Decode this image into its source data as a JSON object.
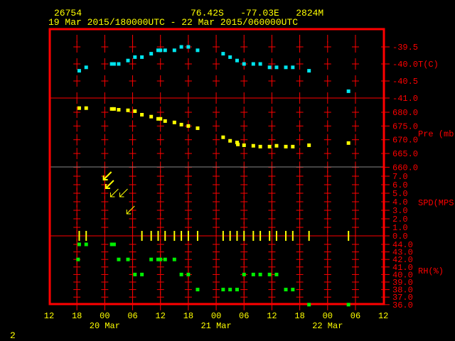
{
  "header": {
    "station": "26754",
    "location": "76.42S   -77.03E   2824M",
    "period": "19 Mar 2015/180000UTC - 22 Mar 2015/060000UTC"
  },
  "footer": {
    "page": "2"
  },
  "colors": {
    "frame": "#ff0000",
    "temperature": "#00e5ee",
    "pressure": "#ffff00",
    "wind": "#ffff00",
    "rh": "#00ee00",
    "text": "#ffff00",
    "axis_text": "#ff0000"
  },
  "chart_data": {
    "type": "scatter",
    "x_axis": {
      "range": [
        "2015-03-19 12:00",
        "2015-03-22 12:00"
      ],
      "tick_labels": [
        "12",
        "18",
        "00",
        "06",
        "12",
        "18",
        "00",
        "06",
        "12",
        "18",
        "00",
        "06",
        "12"
      ],
      "day_labels": [
        "20 Mar",
        "21 Mar",
        "22 Mar"
      ]
    },
    "panels": [
      {
        "id": "temperature",
        "unit_label": "T(C)",
        "ylim": [
          -41.0,
          -39.5
        ],
        "tick_labels": [
          "-39.5",
          "-40.0",
          "-40.5",
          "-41.0"
        ],
        "points": [
          [
            "2015-03-19 18:30",
            -40.2
          ],
          [
            "2015-03-19 20:00",
            -40.1
          ],
          [
            "2015-03-20 01:30",
            -40.0
          ],
          [
            "2015-03-20 02:00",
            -40.0
          ],
          [
            "2015-03-20 03:00",
            -40.0
          ],
          [
            "2015-03-20 05:00",
            -39.9
          ],
          [
            "2015-03-20 06:30",
            -39.8
          ],
          [
            "2015-03-20 08:00",
            -39.8
          ],
          [
            "2015-03-20 10:00",
            -39.7
          ],
          [
            "2015-03-20 11:30",
            -39.6
          ],
          [
            "2015-03-20 12:00",
            -39.6
          ],
          [
            "2015-03-20 13:00",
            -39.6
          ],
          [
            "2015-03-20 15:00",
            -39.6
          ],
          [
            "2015-03-20 16:30",
            -39.5
          ],
          [
            "2015-03-20 18:00",
            -39.5
          ],
          [
            "2015-03-20 20:00",
            -39.6
          ],
          [
            "2015-03-21 01:30",
            -39.7
          ],
          [
            "2015-03-21 03:00",
            -39.8
          ],
          [
            "2015-03-21 04:30",
            -39.9
          ],
          [
            "2015-03-21 06:00",
            -40.0
          ],
          [
            "2015-03-21 08:00",
            -40.0
          ],
          [
            "2015-03-21 09:30",
            -40.0
          ],
          [
            "2015-03-21 11:30",
            -40.1
          ],
          [
            "2015-03-21 13:00",
            -40.1
          ],
          [
            "2015-03-21 15:00",
            -40.1
          ],
          [
            "2015-03-21 16:30",
            -40.1
          ],
          [
            "2015-03-21 20:00",
            -40.2
          ],
          [
            "2015-03-22 04:30",
            -40.8
          ]
        ]
      },
      {
        "id": "pressure",
        "unit_label": "Pre (mb)",
        "ylim": [
          660.0,
          682.5
        ],
        "tick_labels": [
          "680.0",
          "675.0",
          "670.0",
          "665.0",
          "660.0"
        ],
        "points": [
          [
            "2015-03-19 18:30",
            681.5
          ],
          [
            "2015-03-19 20:00",
            681.5
          ],
          [
            "2015-03-20 01:30",
            681.2
          ],
          [
            "2015-03-20 02:00",
            681.2
          ],
          [
            "2015-03-20 03:00",
            680.9
          ],
          [
            "2015-03-20 05:00",
            680.7
          ],
          [
            "2015-03-20 06:30",
            680.4
          ],
          [
            "2015-03-20 08:00",
            679.1
          ],
          [
            "2015-03-20 10:00",
            678.4
          ],
          [
            "2015-03-20 11:30",
            677.6
          ],
          [
            "2015-03-20 12:00",
            677.6
          ],
          [
            "2015-03-20 13:00",
            676.8
          ],
          [
            "2015-03-20 15:00",
            676.3
          ],
          [
            "2015-03-20 16:30",
            675.5
          ],
          [
            "2015-03-20 18:00",
            675.0
          ],
          [
            "2015-03-20 20:00",
            674.2
          ],
          [
            "2015-03-21 01:30",
            670.9
          ],
          [
            "2015-03-21 03:00",
            669.6
          ],
          [
            "2015-03-21 04:30",
            669.0
          ],
          [
            "2015-03-21 04:40",
            668.3
          ],
          [
            "2015-03-21 06:00",
            668.0
          ],
          [
            "2015-03-21 08:00",
            667.8
          ],
          [
            "2015-03-21 09:30",
            667.5
          ],
          [
            "2015-03-21 11:30",
            667.5
          ],
          [
            "2015-03-21 13:00",
            667.8
          ],
          [
            "2015-03-21 15:00",
            667.5
          ],
          [
            "2015-03-21 16:30",
            667.5
          ],
          [
            "2015-03-21 20:00",
            668.0
          ],
          [
            "2015-03-22 04:30",
            668.8
          ]
        ]
      },
      {
        "id": "wind",
        "unit_label": "SPD(MPS)",
        "ylim": [
          0.0,
          7.5
        ],
        "tick_labels": [
          "7.0",
          "6.0",
          "5.0",
          "4.0",
          "3.0",
          "2.0",
          "1.0",
          "0.0"
        ],
        "arrows": [
          [
            "2015-03-20 00:30",
            7.0,
            45
          ],
          [
            "2015-03-20 01:00",
            6.0,
            45
          ],
          [
            "2015-03-20 02:00",
            5.0,
            45
          ],
          [
            "2015-03-20 04:00",
            5.0,
            45
          ],
          [
            "2015-03-20 05:30",
            3.0,
            45
          ]
        ],
        "calm": [
          "2015-03-19 18:30",
          "2015-03-19 20:00",
          "2015-03-20 08:00",
          "2015-03-20 10:00",
          "2015-03-20 11:30",
          "2015-03-20 13:00",
          "2015-03-20 15:00",
          "2015-03-20 16:30",
          "2015-03-20 18:00",
          "2015-03-20 20:00",
          "2015-03-21 01:30",
          "2015-03-21 03:00",
          "2015-03-21 04:30",
          "2015-03-21 06:00",
          "2015-03-21 08:00",
          "2015-03-21 09:30",
          "2015-03-21 11:30",
          "2015-03-21 13:00",
          "2015-03-21 15:00",
          "2015-03-21 16:30",
          "2015-03-21 20:00",
          "2015-03-22 04:30"
        ]
      },
      {
        "id": "rh",
        "unit_label": "RH(%)",
        "ylim": [
          36.0,
          44.0
        ],
        "tick_labels": [
          "44.0",
          "43.0",
          "42.0",
          "41.0",
          "40.0",
          "39.0",
          "38.0",
          "37.0",
          "36.0"
        ],
        "points": [
          [
            "2015-03-19 18:30",
            44
          ],
          [
            "2015-03-19 20:00",
            44
          ],
          [
            "2015-03-20 01:30",
            44
          ],
          [
            "2015-03-20 02:00",
            44
          ],
          [
            "2015-03-19 18:15",
            42
          ],
          [
            "2015-03-20 03:00",
            42
          ],
          [
            "2015-03-20 05:00",
            42
          ],
          [
            "2015-03-20 10:00",
            42
          ],
          [
            "2015-03-20 11:30",
            42
          ],
          [
            "2015-03-20 12:00",
            42
          ],
          [
            "2015-03-20 13:00",
            42
          ],
          [
            "2015-03-20 15:00",
            42
          ],
          [
            "2015-03-20 06:30",
            40
          ],
          [
            "2015-03-20 08:00",
            40
          ],
          [
            "2015-03-20 16:30",
            40
          ],
          [
            "2015-03-20 18:00",
            40
          ],
          [
            "2015-03-20 20:00",
            38
          ],
          [
            "2015-03-21 01:30",
            38
          ],
          [
            "2015-03-21 03:00",
            38
          ],
          [
            "2015-03-21 04:30",
            38
          ],
          [
            "2015-03-21 06:00",
            40
          ],
          [
            "2015-03-21 08:00",
            40
          ],
          [
            "2015-03-21 09:30",
            40
          ],
          [
            "2015-03-21 11:30",
            40
          ],
          [
            "2015-03-21 13:00",
            40
          ],
          [
            "2015-03-21 15:00",
            38
          ],
          [
            "2015-03-21 16:30",
            38
          ],
          [
            "2015-03-21 20:00",
            36
          ],
          [
            "2015-03-22 04:30",
            36
          ]
        ]
      }
    ],
    "grid": true
  }
}
